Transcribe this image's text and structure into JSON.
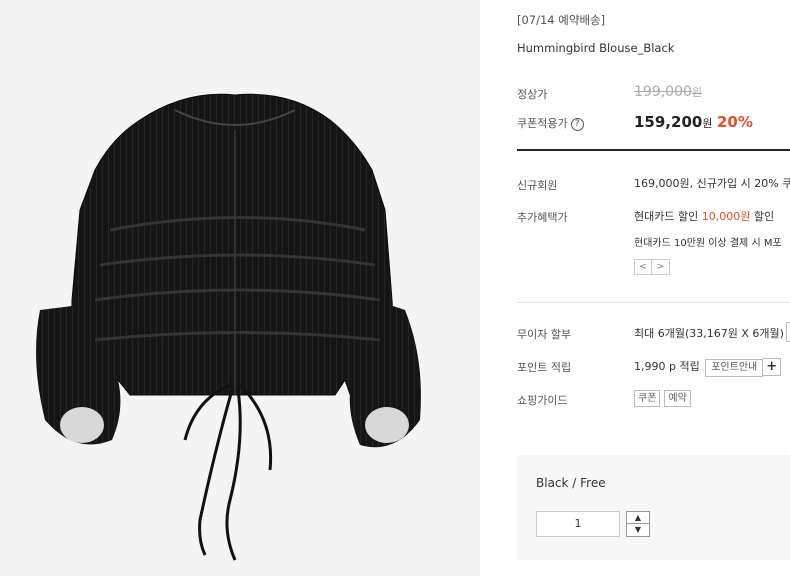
{
  "product": {
    "image_alt": "Black sheer ruffled blouse with ties",
    "preorder_notice": "[07/14 예약배송]",
    "name": "Hummingbird Blouse_Black"
  },
  "pricing": {
    "normal_label": "정상가",
    "normal_price": "199,000",
    "normal_unit": "원",
    "coupon_label": "쿠폰적용가",
    "coupon_price": "159,200",
    "coupon_unit": "원",
    "discount": "20%"
  },
  "benefits": {
    "new_member_label": "신규회원",
    "new_member_text": "169,000원, 신규가입 시 20% 쿠",
    "extra_label": "추가혜택가",
    "extra_prefix": "현대카드 할인 ",
    "extra_amount": "10,000원",
    "extra_suffix": " 할인",
    "extra_sub": "현대카드 10만원 이상 결제 시 M포",
    "prev_glyph": "<",
    "next_glyph": ">"
  },
  "payment": {
    "installment_label": "무이자 할부",
    "installment_text": "최대 6개월(33,167원 X 6개월)",
    "points_label": "포인트 적립",
    "points_value": "1,990 p",
    "points_text": "적립",
    "points_button": "포인트안내",
    "plus_glyph": "+",
    "guide_label": "쇼핑가이드",
    "guide_tags": [
      "쿠폰",
      "예약"
    ]
  },
  "option": {
    "label": "Black / Free",
    "quantity": "1",
    "up_glyph": "▲",
    "down_glyph": "▼"
  },
  "icons": {
    "help_icon": "?"
  },
  "colors": {
    "accent": "#e2502a",
    "garment": "#141414"
  }
}
